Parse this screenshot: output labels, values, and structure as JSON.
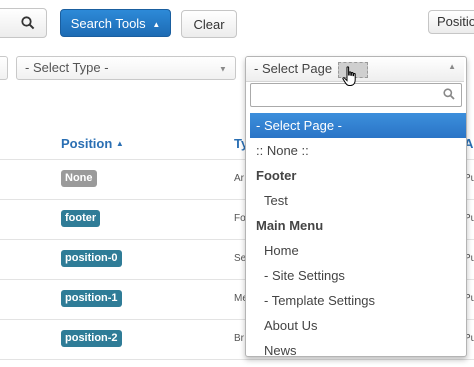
{
  "toolbar": {
    "search_icon": "search-icon",
    "search_tools_label": "Search Tools",
    "search_tools_caret": "▲",
    "clear_label": "Clear",
    "position_partial": "Positio"
  },
  "filters": {
    "type_select": "- Select Type -",
    "page_select": "- Select Page",
    "caret": "▲"
  },
  "table": {
    "columns": {
      "position": "Position",
      "position_sort": "▲",
      "type_partial": "Ty",
      "access_partial": "A"
    },
    "rows": [
      {
        "badge": "None",
        "type_snip": "Ar",
        "access_snip": "Pu"
      },
      {
        "badge": "footer",
        "type_snip": "Fo",
        "access_snip": "Pu"
      },
      {
        "badge": "position-0",
        "type_snip": "Se",
        "access_snip": "Pu"
      },
      {
        "badge": "position-1",
        "type_snip": "Me",
        "access_snip": "Pu"
      },
      {
        "badge": "position-2",
        "type_snip": "Br",
        "access_snip": "Pu"
      }
    ]
  },
  "dropdown": {
    "search_placeholder": "",
    "options": [
      {
        "label": "- Select Page -",
        "kind": "highlighted"
      },
      {
        "label": ":: None ::",
        "kind": "option"
      },
      {
        "label": "Footer",
        "kind": "group"
      },
      {
        "label": "Test",
        "kind": "child"
      },
      {
        "label": "Main Menu",
        "kind": "group"
      },
      {
        "label": "Home",
        "kind": "child"
      },
      {
        "label": "- Site Settings",
        "kind": "child"
      },
      {
        "label": "- Template Settings",
        "kind": "child"
      },
      {
        "label": "About Us",
        "kind": "child"
      },
      {
        "label": "News",
        "kind": "child"
      }
    ]
  },
  "colors": {
    "primary": "#1f70bb",
    "badge": "#2f7c97",
    "badge_none": "#9a9a9a",
    "header_link": "#2a6fb3"
  }
}
